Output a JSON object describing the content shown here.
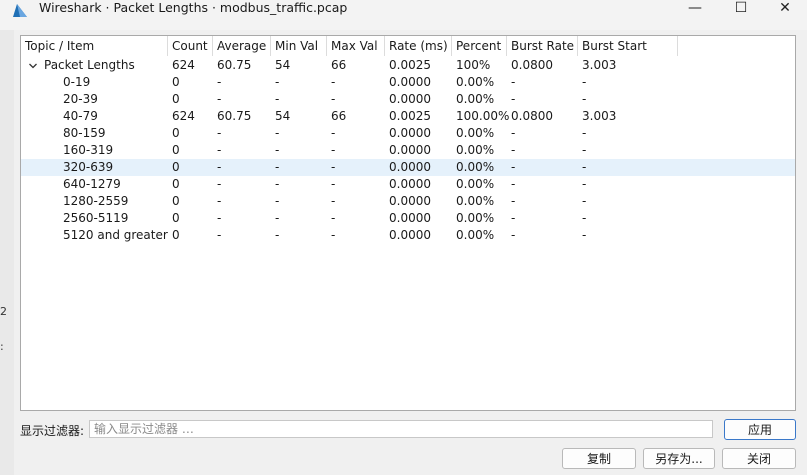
{
  "window": {
    "title": "Wireshark · Packet Lengths · modbus_traffic.pcap",
    "minimize_glyph": "—",
    "maximize_glyph": "☐",
    "close_glyph": "✕"
  },
  "icons": {
    "app": "wireshark-fin-icon",
    "expand": "chevron-down-icon"
  },
  "colors": {
    "selected_row": "#e5f1fb",
    "apply_border": "#3a78c9",
    "wireshark_blue": "#1f6fb5"
  },
  "left_strip": {
    "mark1": "2",
    "mark2": ":"
  },
  "table": {
    "columns": [
      "Topic / Item",
      "Count",
      "Average",
      "Min Val",
      "Max Val",
      "Rate (ms)",
      "Percent",
      "Burst Rate",
      "Burst Start"
    ],
    "group": {
      "topic": "Packet Lengths",
      "count": "624",
      "average": "60.75",
      "min": "54",
      "max": "66",
      "rate": "0.0025",
      "percent": "100%",
      "burst_rate": "0.0800",
      "burst_start": "3.003"
    },
    "rows": [
      {
        "topic": "0-19",
        "count": "0",
        "average": "-",
        "min": "-",
        "max": "-",
        "rate": "0.0000",
        "percent": "0.00%",
        "burst_rate": "-",
        "burst_start": "-"
      },
      {
        "topic": "20-39",
        "count": "0",
        "average": "-",
        "min": "-",
        "max": "-",
        "rate": "0.0000",
        "percent": "0.00%",
        "burst_rate": "-",
        "burst_start": "-"
      },
      {
        "topic": "40-79",
        "count": "624",
        "average": "60.75",
        "min": "54",
        "max": "66",
        "rate": "0.0025",
        "percent": "100.00%",
        "burst_rate": "0.0800",
        "burst_start": "3.003"
      },
      {
        "topic": "80-159",
        "count": "0",
        "average": "-",
        "min": "-",
        "max": "-",
        "rate": "0.0000",
        "percent": "0.00%",
        "burst_rate": "-",
        "burst_start": "-"
      },
      {
        "topic": "160-319",
        "count": "0",
        "average": "-",
        "min": "-",
        "max": "-",
        "rate": "0.0000",
        "percent": "0.00%",
        "burst_rate": "-",
        "burst_start": "-"
      },
      {
        "topic": "320-639",
        "count": "0",
        "average": "-",
        "min": "-",
        "max": "-",
        "rate": "0.0000",
        "percent": "0.00%",
        "burst_rate": "-",
        "burst_start": "-"
      },
      {
        "topic": "640-1279",
        "count": "0",
        "average": "-",
        "min": "-",
        "max": "-",
        "rate": "0.0000",
        "percent": "0.00%",
        "burst_rate": "-",
        "burst_start": "-"
      },
      {
        "topic": "1280-2559",
        "count": "0",
        "average": "-",
        "min": "-",
        "max": "-",
        "rate": "0.0000",
        "percent": "0.00%",
        "burst_rate": "-",
        "burst_start": "-"
      },
      {
        "topic": "2560-5119",
        "count": "0",
        "average": "-",
        "min": "-",
        "max": "-",
        "rate": "0.0000",
        "percent": "0.00%",
        "burst_rate": "-",
        "burst_start": "-"
      },
      {
        "topic": "5120 and greater",
        "count": "0",
        "average": "-",
        "min": "-",
        "max": "-",
        "rate": "0.0000",
        "percent": "0.00%",
        "burst_rate": "-",
        "burst_start": "-"
      }
    ],
    "selected_row_index": 5
  },
  "filter": {
    "label": "显示过滤器:",
    "placeholder": "输入显示过滤器 …",
    "value": "",
    "apply_label": "应用"
  },
  "buttons": {
    "copy": "复制",
    "save_as": "另存为...",
    "close": "关闭"
  }
}
